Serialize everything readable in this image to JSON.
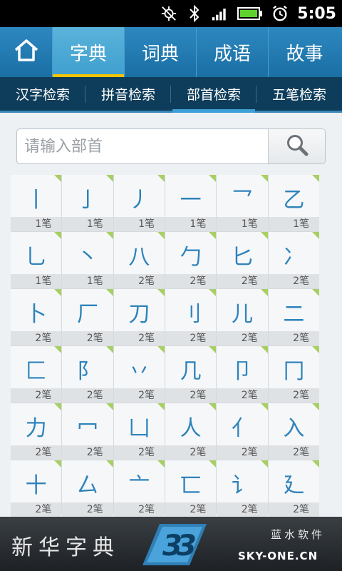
{
  "status_bar": {
    "time": "5:05",
    "icons": [
      "gps-off-icon",
      "bluetooth-icon",
      "signal-icon",
      "battery-icon",
      "alarm-icon"
    ]
  },
  "main_tabs": [
    {
      "label": "",
      "icon": "home-icon",
      "active": false
    },
    {
      "label": "字典",
      "active": true
    },
    {
      "label": "词典",
      "active": false
    },
    {
      "label": "成语",
      "active": false
    },
    {
      "label": "故事",
      "active": false
    }
  ],
  "sub_tabs": [
    {
      "label": "汉字检索",
      "active": false
    },
    {
      "label": "拼音检索",
      "active": false
    },
    {
      "label": "部首检索",
      "active": true
    },
    {
      "label": "五笔检索",
      "active": false
    }
  ],
  "search": {
    "placeholder": "请输入部首",
    "value": "",
    "button_icon": "search-icon"
  },
  "radicals": [
    {
      "glyph": "丨",
      "strokes": "1笔"
    },
    {
      "glyph": "亅",
      "strokes": "1笔"
    },
    {
      "glyph": "丿",
      "strokes": "1笔"
    },
    {
      "glyph": "一",
      "strokes": "1笔"
    },
    {
      "glyph": "乛",
      "strokes": "1笔"
    },
    {
      "glyph": "乙",
      "strokes": "1笔"
    },
    {
      "glyph": "乚",
      "strokes": "1笔"
    },
    {
      "glyph": "丶",
      "strokes": "1笔"
    },
    {
      "glyph": "八",
      "strokes": "2笔"
    },
    {
      "glyph": "勹",
      "strokes": "2笔"
    },
    {
      "glyph": "匕",
      "strokes": "2笔"
    },
    {
      "glyph": "冫",
      "strokes": "2笔"
    },
    {
      "glyph": "卜",
      "strokes": "2笔"
    },
    {
      "glyph": "厂",
      "strokes": "2笔"
    },
    {
      "glyph": "刀",
      "strokes": "2笔"
    },
    {
      "glyph": "刂",
      "strokes": "2笔"
    },
    {
      "glyph": "儿",
      "strokes": "2笔"
    },
    {
      "glyph": "二",
      "strokes": "2笔"
    },
    {
      "glyph": "匚",
      "strokes": "2笔"
    },
    {
      "glyph": "阝",
      "strokes": "2笔"
    },
    {
      "glyph": "丷",
      "strokes": "2笔"
    },
    {
      "glyph": "几",
      "strokes": "2笔"
    },
    {
      "glyph": "卩",
      "strokes": "2笔"
    },
    {
      "glyph": "冂",
      "strokes": "2笔"
    },
    {
      "glyph": "力",
      "strokes": "2笔"
    },
    {
      "glyph": "冖",
      "strokes": "2笔"
    },
    {
      "glyph": "凵",
      "strokes": "2笔"
    },
    {
      "glyph": "人",
      "strokes": "2笔"
    },
    {
      "glyph": "亻",
      "strokes": "2笔"
    },
    {
      "glyph": "入",
      "strokes": "2笔"
    },
    {
      "glyph": "十",
      "strokes": "2笔"
    },
    {
      "glyph": "厶",
      "strokes": "2笔"
    },
    {
      "glyph": "亠",
      "strokes": "2笔"
    },
    {
      "glyph": "匸",
      "strokes": "2笔"
    },
    {
      "glyph": "讠",
      "strokes": "2笔"
    },
    {
      "glyph": "廴",
      "strokes": "2笔"
    }
  ],
  "footer": {
    "app_title": "新华字典",
    "company": "蓝水软件",
    "url": "SKY-ONE.CN",
    "logo_icon": "sky-one-logo"
  },
  "colors": {
    "tab_bar": "#1f78ad",
    "active_tab_underline": "#f4c400",
    "sub_tab_bar": "#0e3d5b",
    "radical_text": "#2e83bb",
    "cell_corner": "#a8cf63"
  }
}
